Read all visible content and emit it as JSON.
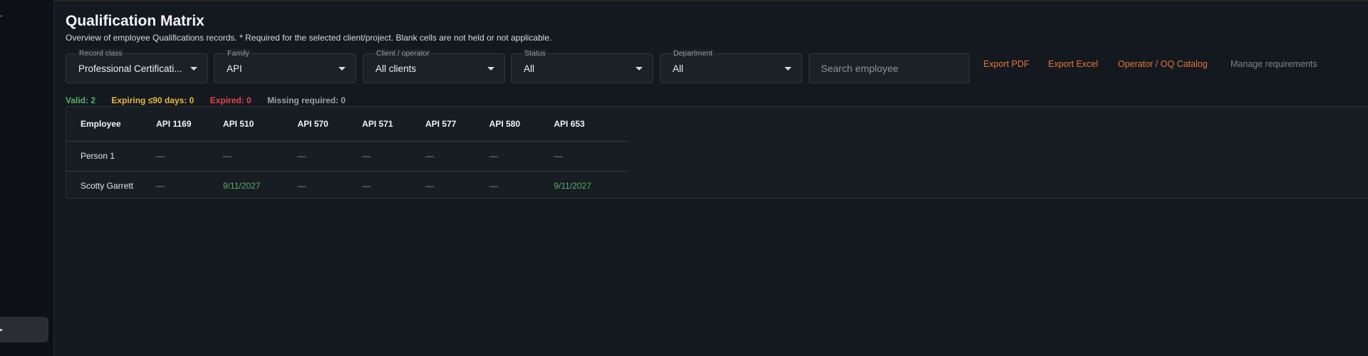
{
  "page": {
    "title": "Qualification Matrix",
    "subtitle": "Overview of employee Qualifications records. * Required for the selected client/project. Blank cells are not held or not applicable."
  },
  "filters": {
    "record_class": {
      "label": "Record class",
      "value": "Professional Certificati..."
    },
    "family": {
      "label": "Family",
      "value": "API"
    },
    "client": {
      "label": "Client / operator",
      "value": "All clients"
    },
    "status": {
      "label": "Status",
      "value": "All"
    },
    "department": {
      "label": "Department",
      "value": "All"
    },
    "search": {
      "placeholder": "Search employee",
      "value": ""
    }
  },
  "actions": {
    "export_pdf": "Export PDF",
    "export_excel": "Export Excel",
    "oq_catalog": "Operator / OQ Catalog",
    "manage_requirements": "Manage requirements"
  },
  "stats": {
    "valid": "Valid: 2",
    "expiring": "Expiring ≤90 days: 0",
    "expired": "Expired: 0",
    "missing": "Missing required: 0"
  },
  "colors": {
    "accent": "#e8743b",
    "valid": "#55b06a",
    "expiring": "#e8b93b",
    "expired": "#e0474c",
    "missing": "#9aa1a9"
  },
  "table": {
    "columns": [
      "Employee",
      "API 1169",
      "API 510",
      "API 570",
      "API 571",
      "API 577",
      "API 580",
      "API 653"
    ],
    "rows": [
      {
        "cells": [
          "Person 1",
          "—",
          "—",
          "—",
          "—",
          "—",
          "—",
          "—"
        ]
      },
      {
        "cells": [
          "Scotty Garrett",
          "—",
          "9/11/2027",
          "—",
          "—",
          "—",
          "—",
          "9/11/2027"
        ]
      }
    ]
  }
}
